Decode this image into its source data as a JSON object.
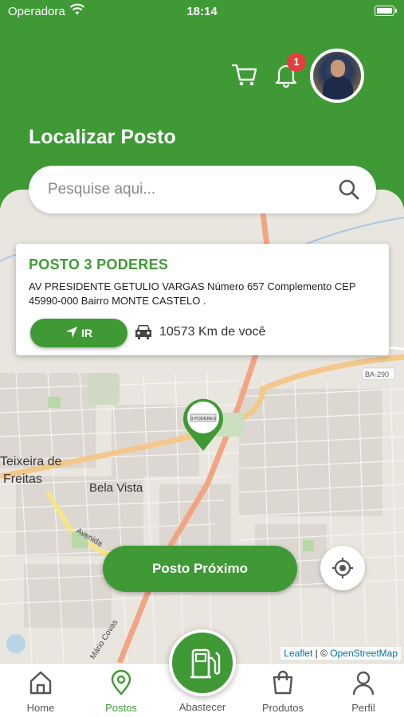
{
  "status_bar": {
    "carrier": "Operadora",
    "time": "18:14"
  },
  "header": {
    "title": "Localizar Posto",
    "notifications_count": "1",
    "icons": [
      "cart-icon",
      "bell-icon",
      "avatar"
    ]
  },
  "search": {
    "placeholder": "Pesquise aqui..."
  },
  "station_card": {
    "name": "POSTO 3 PODERES",
    "address": "AV PRESIDENTE GETULIO VARGAS Número 657 Complemento CEP 45990-000 Bairro MONTE CASTELO .",
    "go_label": "IR",
    "distance": "10573 Km de você"
  },
  "map": {
    "labels": [
      "Teixeira de",
      "Freitas",
      "Bela Vista",
      "BA-290",
      "Avenida",
      "Mário Covas"
    ],
    "marker_label": "3 PODERES"
  },
  "buttons": {
    "nearest": "Posto Próximo"
  },
  "attribution": {
    "leaflet": "Leaflet",
    "separator": " | © ",
    "osm": "OpenStreetMap"
  },
  "tabs": [
    {
      "label": "Home",
      "icon": "home-icon",
      "active": false
    },
    {
      "label": "Postos",
      "icon": "map-pin-icon",
      "active": true
    },
    {
      "label": "Abastecer",
      "icon": "fuel-pump-icon",
      "active": false
    },
    {
      "label": "Produtos",
      "icon": "shopping-bag-icon",
      "active": false
    },
    {
      "label": "Perfil",
      "icon": "user-icon",
      "active": false
    }
  ],
  "colors": {
    "primary": "#3f9a35",
    "badge": "#e53e3e",
    "map_bg": "#e9e6df",
    "road_major": "#f2a585"
  }
}
